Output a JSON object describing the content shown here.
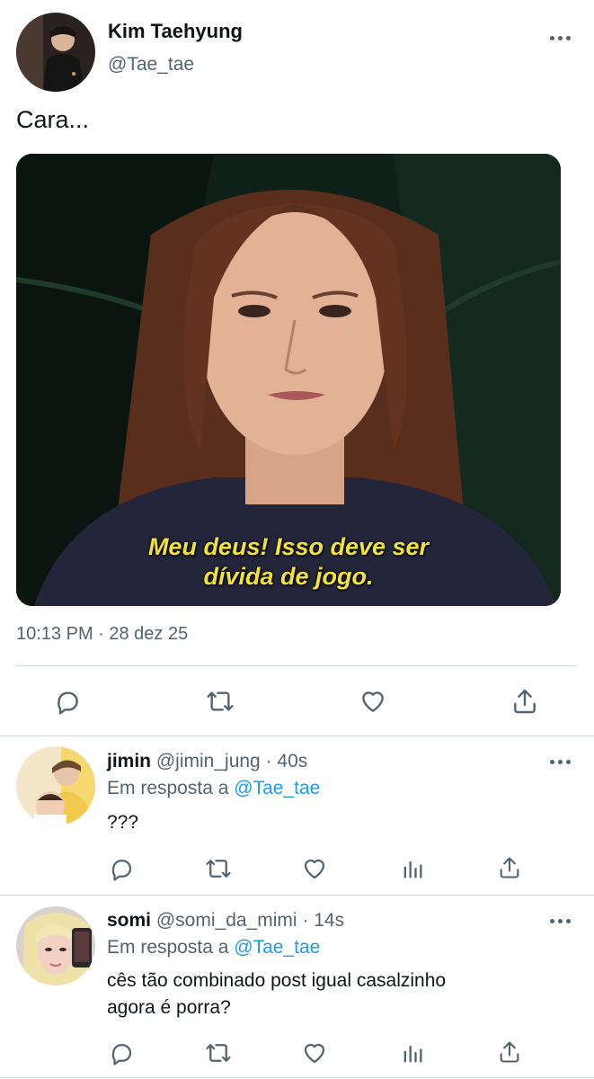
{
  "main_tweet": {
    "author_name": "Kim Taehyung",
    "handle": "@Tae_tae",
    "text": "Cara...",
    "media_caption_line1": "Meu deus! Isso deve ser",
    "media_caption_line2": "dívida de jogo.",
    "timestamp": "10:13 PM · 28 dez 25"
  },
  "replies": [
    {
      "name": "jimin",
      "handle": "@jimin_jung",
      "time": "· 40s",
      "reply_prefix": "Em resposta a",
      "reply_to": "@Tae_tae",
      "text": "???"
    },
    {
      "name": "somi",
      "handle": "@somi_da_mimi",
      "time": "· 14s",
      "reply_prefix": "Em resposta a",
      "reply_to": "@Tae_tae",
      "text_line1": "cês tão combinado post igual casalzinho",
      "text_line2": "agora é porra?"
    }
  ],
  "colors": {
    "text": "#0f1419",
    "secondary": "#536471",
    "link": "#1d9bf0",
    "caption": "#f2e23a",
    "divider": "#cfd9de"
  },
  "icons": [
    "more-icon",
    "reply-icon",
    "retweet-icon",
    "like-icon",
    "share-icon",
    "analytics-icon"
  ]
}
